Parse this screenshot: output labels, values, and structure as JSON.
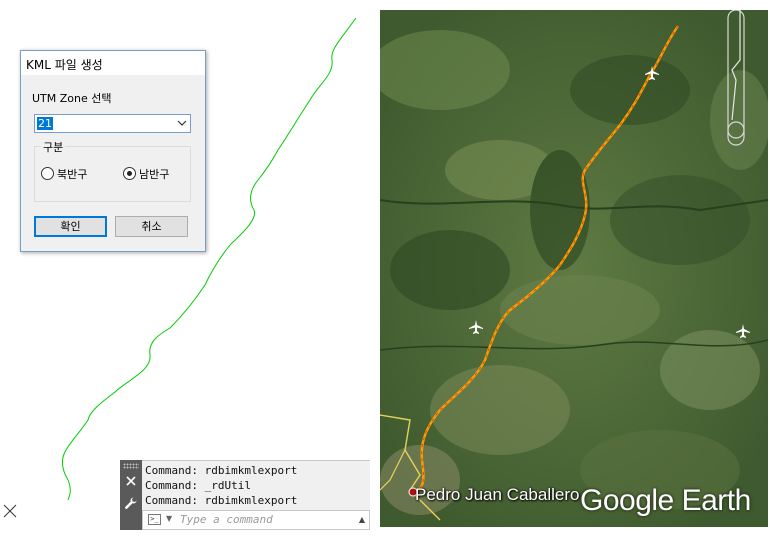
{
  "dialog": {
    "title": "KML 파일 생성",
    "zone_label": "UTM Zone 선택",
    "zone_value": "21",
    "group_label": "구분",
    "north_label": "북반구",
    "south_label": "남반구",
    "selected_hemisphere": "남반구",
    "ok_label": "확인",
    "cancel_label": "취소"
  },
  "command": {
    "history": [
      "Command: rdbimkmlexport",
      "Command: _rdUtil",
      "Command: rdbimkmlexport"
    ],
    "placeholder": "Type a command"
  },
  "map": {
    "city_label": "Pedro Juan Caballero",
    "brand": "Google Earth",
    "route_color": "#f5a000",
    "cad_line_color": "#00cc00",
    "icons": [
      "airplane-icon",
      "compass-icon"
    ]
  }
}
